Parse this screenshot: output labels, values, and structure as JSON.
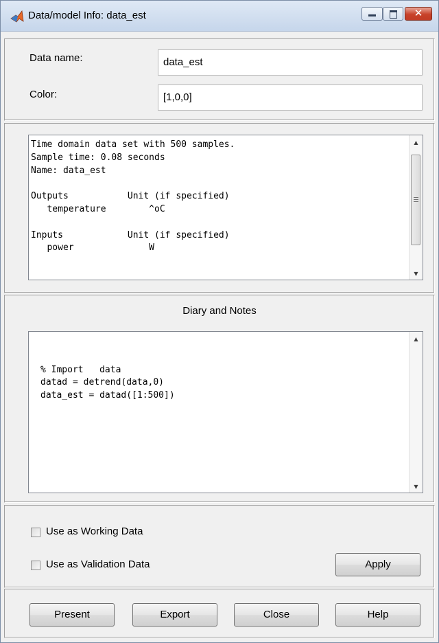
{
  "window": {
    "title": "Data/model Info: data_est",
    "close_glyph": "✕",
    "icons": {
      "app": "matlab-logo-icon",
      "minimize": "minimize-icon",
      "maximize": "maximize-icon",
      "close": "close-icon"
    }
  },
  "properties": {
    "name_label": "Data name:",
    "name_value": "data_est",
    "color_label": "Color:",
    "color_value": "[1,0,0]"
  },
  "info_text": "Time domain data set with 500 samples.\nSample time: 0.08 seconds\nName: data_est\n\nOutputs           Unit (if specified)\n   temperature        ^oC\n\nInputs            Unit (if specified)\n   power              W",
  "diary": {
    "title": "Diary and Notes",
    "text": "\n\n% Import   data\ndatad = detrend(data,0)\ndata_est = datad([1:500])"
  },
  "usage": {
    "working_label": "Use as Working Data",
    "working_checked": false,
    "validation_label": "Use as Validation Data",
    "validation_checked": false,
    "apply_label": "Apply"
  },
  "footer": {
    "present_label": "Present",
    "export_label": "Export",
    "close_label": "Close",
    "help_label": "Help"
  },
  "scroll": {
    "up_glyph": "▲",
    "down_glyph": "▼"
  }
}
